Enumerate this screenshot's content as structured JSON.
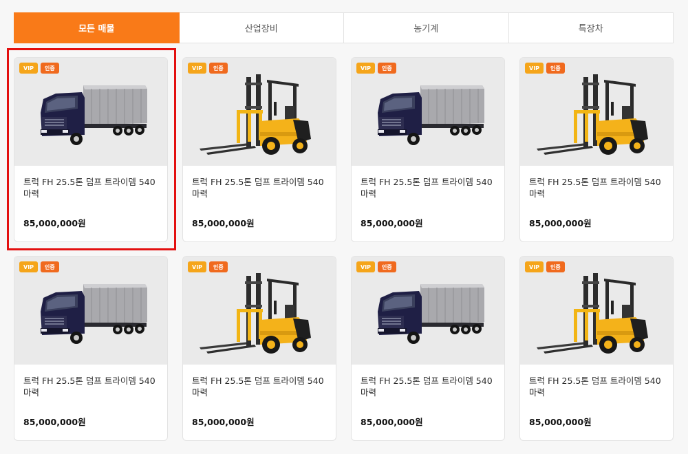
{
  "tabs": [
    {
      "label": "모든 매물",
      "active": true
    },
    {
      "label": "산업장비",
      "active": false
    },
    {
      "label": "농기계",
      "active": false
    },
    {
      "label": "특장차",
      "active": false
    }
  ],
  "listings": [
    {
      "type": "truck",
      "badges": [
        "VIP",
        "인증"
      ],
      "title": "트럭 FH 25.5톤 덤프 트라이뎀 540마력",
      "price": "85,000,000원"
    },
    {
      "type": "forklift",
      "badges": [
        "VIP",
        "인증"
      ],
      "title": "트럭 FH 25.5톤 덤프 트라이뎀 540마력",
      "price": "85,000,000원"
    },
    {
      "type": "truck",
      "badges": [
        "VIP",
        "인증"
      ],
      "title": "트럭 FH 25.5톤 덤프 트라이뎀 540마력",
      "price": "85,000,000원"
    },
    {
      "type": "forklift",
      "badges": [
        "VIP",
        "인증"
      ],
      "title": "트럭 FH 25.5톤 덤프 트라이뎀 540마력",
      "price": "85,000,000원"
    },
    {
      "type": "truck",
      "badges": [
        "VIP",
        "인증"
      ],
      "title": "트럭 FH 25.5톤 덤프 트라이뎀 540마력",
      "price": "85,000,000원"
    },
    {
      "type": "forklift",
      "badges": [
        "VIP",
        "인증"
      ],
      "title": "트럭 FH 25.5톤 덤프 트라이뎀 540마력",
      "price": "85,000,000원"
    },
    {
      "type": "truck",
      "badges": [
        "VIP",
        "인증"
      ],
      "title": "트럭 FH 25.5톤 덤프 트라이뎀 540마력",
      "price": "85,000,000원"
    },
    {
      "type": "forklift",
      "badges": [
        "VIP",
        "인증"
      ],
      "title": "트럭 FH 25.5톤 덤프 트라이뎀 540마력",
      "price": "85,000,000원"
    }
  ],
  "colors": {
    "accent": "#f97a18",
    "vip": "#f5a51a",
    "cert": "#f06a1e",
    "highlight": "#e30f0f"
  }
}
